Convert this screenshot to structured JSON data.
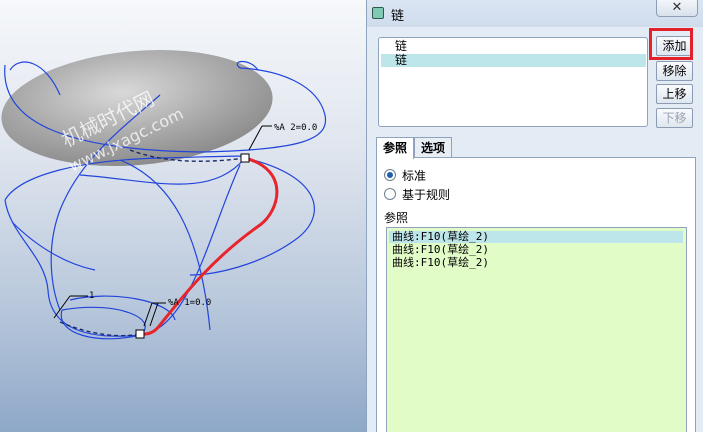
{
  "viewport": {
    "watermark_cn": "机械时代网",
    "watermark_url": "www.jxagc.com",
    "annotation_top": "%A 2=0.0",
    "annotation_bottom": "%A 1=0.0",
    "annotation_id": "1",
    "colors": {
      "curve": "#2244dd",
      "selected_curve": "#e8242c",
      "surface": "#a9a9a9"
    }
  },
  "dialog": {
    "title": "链",
    "close_symbol": "✕",
    "chain_list": [
      {
        "label": "链",
        "selected": false
      },
      {
        "label": "链",
        "selected": true
      }
    ],
    "buttons": {
      "add": "添加",
      "remove": "移除",
      "move_up": "上移",
      "move_down": "下移"
    },
    "tabs": [
      {
        "label": "参照",
        "active": true
      },
      {
        "label": "选项",
        "active": false
      }
    ],
    "radio_options": [
      {
        "label": "标准",
        "checked": true
      },
      {
        "label": "基于规则",
        "checked": false
      }
    ],
    "references_label": "参照",
    "references": [
      {
        "label": "曲线:F10(草绘_2)",
        "selected": true
      },
      {
        "label": "曲线:F10(草绘_2)",
        "selected": false
      },
      {
        "label": "曲线:F10(草绘_2)",
        "selected": false
      }
    ]
  }
}
